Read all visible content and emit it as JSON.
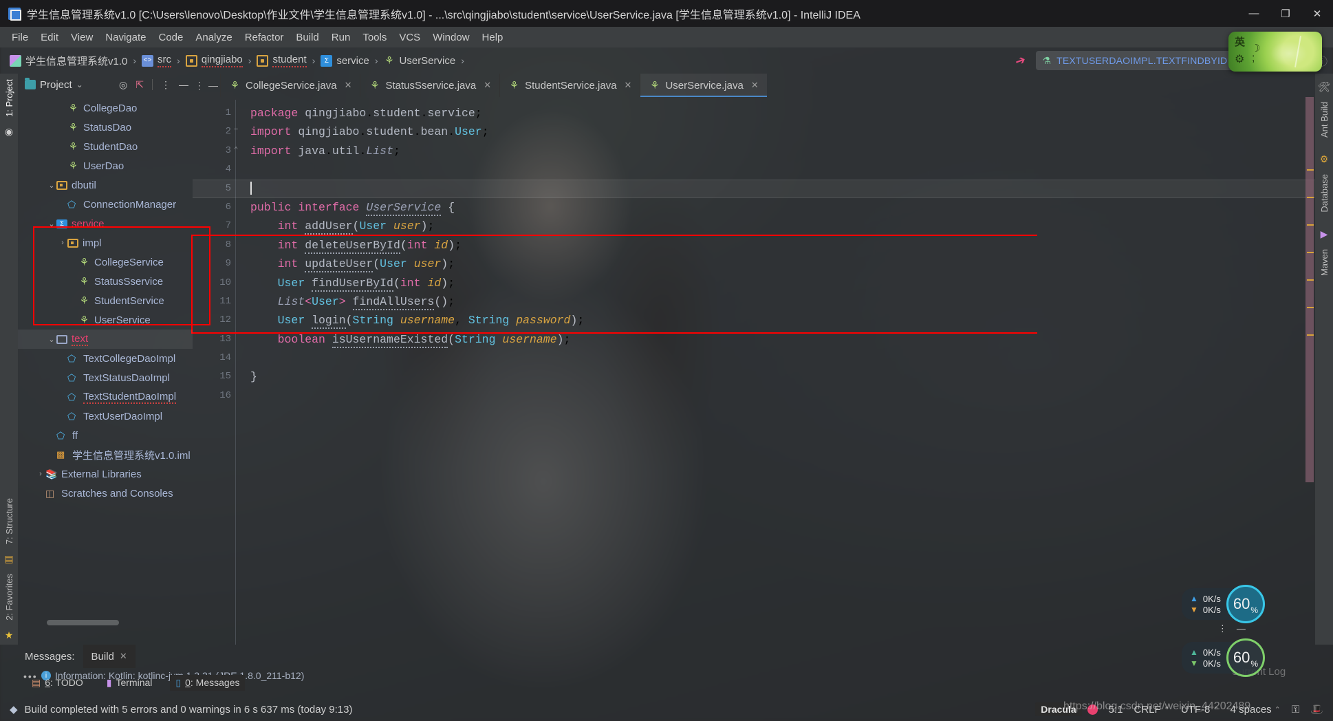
{
  "window": {
    "title": "学生信息管理系统v1.0 [C:\\Users\\lenovo\\Desktop\\作业文件\\学生信息管理系统v1.0] - ...\\src\\qingjiabo\\student\\service\\UserService.java [学生信息管理系统v1.0] - IntelliJ IDEA",
    "minimize": "—",
    "maximize": "❐",
    "close": "✕"
  },
  "menu": {
    "items": [
      "File",
      "Edit",
      "View",
      "Navigate",
      "Code",
      "Analyze",
      "Refactor",
      "Build",
      "Run",
      "Tools",
      "VCS",
      "Window",
      "Help"
    ]
  },
  "breadcrumb": {
    "separator": "›",
    "items": [
      {
        "label": "学生信息管理系统v1.0",
        "icon": "module-icon"
      },
      {
        "label": "src",
        "icon": "source-root-icon"
      },
      {
        "label": "qingjiabo",
        "icon": "package-icon"
      },
      {
        "label": "student",
        "icon": "package-icon"
      },
      {
        "label": "service",
        "icon": "package-blue-icon"
      },
      {
        "label": "UserService",
        "icon": "interface-icon"
      }
    ]
  },
  "toolbar": {
    "build_icon": "hammer-icon",
    "run_config": "TEXTUSERDAOIMPL.TEXTFINDBYID",
    "run_config_caret": "⌄",
    "run_button": "▶",
    "debug_button": "debug-icon",
    "coverage_button": "⊙",
    "profile_button": "ⓘ"
  },
  "left_strip": {
    "tabs": [
      "1: Project",
      "7: Structure",
      "2: Favorites"
    ],
    "bottom_icons": [
      "bookmark-icon",
      "star-icon"
    ]
  },
  "right_strip": {
    "tabs": [
      "Ant Build",
      "Database",
      "Maven"
    ]
  },
  "project_panel": {
    "title": "Project",
    "caret": "⌄",
    "actions": [
      "target-icon",
      "collapse-all-icon",
      "options-icon",
      "hide-icon"
    ],
    "tree": [
      {
        "indent": 3,
        "arrow": "",
        "icon": "interface-icon",
        "label": "CollegeDao",
        "style": ""
      },
      {
        "indent": 3,
        "arrow": "",
        "icon": "interface-icon",
        "label": "StatusDao",
        "style": ""
      },
      {
        "indent": 3,
        "arrow": "",
        "icon": "interface-icon",
        "label": "StudentDao",
        "style": ""
      },
      {
        "indent": 3,
        "arrow": "",
        "icon": "interface-icon",
        "label": "UserDao",
        "style": ""
      },
      {
        "indent": 2,
        "arrow": "⌄",
        "icon": "folder-icon",
        "label": "dbutil",
        "style": ""
      },
      {
        "indent": 3,
        "arrow": "",
        "icon": "class-icon",
        "label": "ConnectionManager",
        "style": ""
      },
      {
        "indent": 2,
        "arrow": "⌄",
        "icon": "folder-blue-icon",
        "label": "service",
        "style": "err"
      },
      {
        "indent": 3,
        "arrow": "›",
        "icon": "folder-icon",
        "label": "impl",
        "style": ""
      },
      {
        "indent": 4,
        "arrow": "",
        "icon": "interface-icon",
        "label": "CollegeService",
        "style": ""
      },
      {
        "indent": 4,
        "arrow": "",
        "icon": "interface-icon",
        "label": "StatusSservice",
        "style": ""
      },
      {
        "indent": 4,
        "arrow": "",
        "icon": "interface-icon",
        "label": "StudentService",
        "style": ""
      },
      {
        "indent": 4,
        "arrow": "",
        "icon": "interface-icon",
        "label": "UserService",
        "style": ""
      },
      {
        "indent": 2,
        "arrow": "⌄",
        "icon": "folder-plain-icon",
        "label": "text",
        "style": "errud",
        "selected": true
      },
      {
        "indent": 3,
        "arrow": "",
        "icon": "class-icon",
        "label": "TextCollegeDaoImpl",
        "style": ""
      },
      {
        "indent": 3,
        "arrow": "",
        "icon": "class-icon",
        "label": "TextStatusDaoImpl",
        "style": ""
      },
      {
        "indent": 3,
        "arrow": "",
        "icon": "class-icon",
        "label": "TextStudentDaoImpl",
        "style": "ud"
      },
      {
        "indent": 3,
        "arrow": "",
        "icon": "class-icon",
        "label": "TextUserDaoImpl",
        "style": ""
      },
      {
        "indent": 2,
        "arrow": "",
        "icon": "class-icon",
        "label": "ff",
        "style": ""
      },
      {
        "indent": 2,
        "arrow": "",
        "icon": "iml-icon",
        "label": "学生信息管理系统v1.0.iml",
        "style": ""
      },
      {
        "indent": 1,
        "arrow": "›",
        "icon": "library-icon",
        "label": "External Libraries",
        "style": ""
      },
      {
        "indent": 1,
        "arrow": "",
        "icon": "scratches-icon",
        "label": "Scratches and Consoles",
        "style": ""
      }
    ]
  },
  "editor": {
    "tabs": [
      {
        "label": "CollegeService.java",
        "icon": "interface-icon",
        "active": false,
        "close": "✕"
      },
      {
        "label": "StatusSservice.java",
        "icon": "interface-icon",
        "active": false,
        "close": "✕"
      },
      {
        "label": "StudentService.java",
        "icon": "interface-icon",
        "active": false,
        "close": "✕"
      },
      {
        "label": "UserService.java",
        "icon": "interface-icon",
        "active": true,
        "close": "✕"
      }
    ],
    "tab_options_icon": "⋮",
    "tab_hide_icon": "—",
    "caret_line": 5,
    "lines": [
      {
        "n": 1,
        "fold": ""
      },
      {
        "n": 2,
        "fold": "−"
      },
      {
        "n": 3,
        "fold": "⌃"
      },
      {
        "n": 4,
        "fold": ""
      },
      {
        "n": 5,
        "fold": ""
      },
      {
        "n": 6,
        "fold": ""
      },
      {
        "n": 7,
        "fold": ""
      },
      {
        "n": 8,
        "fold": ""
      },
      {
        "n": 9,
        "fold": ""
      },
      {
        "n": 10,
        "fold": ""
      },
      {
        "n": 11,
        "fold": ""
      },
      {
        "n": 12,
        "fold": ""
      },
      {
        "n": 13,
        "fold": ""
      },
      {
        "n": 14,
        "fold": ""
      },
      {
        "n": 15,
        "fold": ""
      },
      {
        "n": 16,
        "fold": ""
      }
    ],
    "source_text": [
      "package qingjiabo.student.service;",
      "import qingjiabo.student.bean.User;",
      "import java.util.List;",
      "",
      "",
      "public interface UserService {",
      "    int addUser(User user);",
      "    int deleteUserById(int id);",
      "    int updateUser(User user);",
      "    User findUserById(int id);",
      "    List<User> findAllUsers();",
      "    User login(String username, String password);",
      "    boolean isUsernameExisted(String username);",
      "",
      "}",
      ""
    ]
  },
  "messages_panel": {
    "label": "Messages:",
    "tab": "Build",
    "tab_close": "✕",
    "more": "•••",
    "entry": "Information: Kotlin: kotlinc-jvm 1.3.21 (JRE 1.8.0_211-b12)"
  },
  "tool_windows": [
    {
      "num": "6",
      "label": ": TODO",
      "icon": "todo-icon",
      "active": false
    },
    {
      "num": "",
      "label": "Terminal",
      "icon": "terminal-icon",
      "active": false
    },
    {
      "num": "0",
      "label": ": Messages",
      "icon": "messages-icon",
      "active": true
    }
  ],
  "status_bar": {
    "icon": "event-log-icon",
    "message": "Build completed with 5 errors and 0 warnings in 6 s 637 ms (today 9:13)",
    "scheme": "Dracula",
    "caret_position": "5:1",
    "line_separator": "CRLF",
    "encoding": "UTF-8",
    "indent": "4 spaces",
    "lock_icon": "⚿",
    "inspection_icon": "🎩",
    "chevron": "⌃"
  },
  "watermark": "https://blog.csdn.net/weixin_44202489",
  "ime_widget": {
    "mode": "英",
    "moon": "☽",
    "gear": "⚙",
    "semicolon": ";"
  },
  "net_widgets": [
    {
      "up": "0K/s",
      "down": "0K/s",
      "percent": "60",
      "percent_symbol": "%"
    },
    {
      "up": "0K/s",
      "down": "0K/s",
      "percent": "60",
      "percent_symbol": "%"
    }
  ],
  "current_log_label": "Current Log",
  "colors": {
    "accent": "#4a88c7",
    "annotation_red": "#ff0000",
    "keyword_pink": "#e06ca8",
    "type_cyan": "#62c1e0",
    "param_orange": "#d9a441",
    "error_red": "#e8416f",
    "run_green": "#62b543"
  }
}
